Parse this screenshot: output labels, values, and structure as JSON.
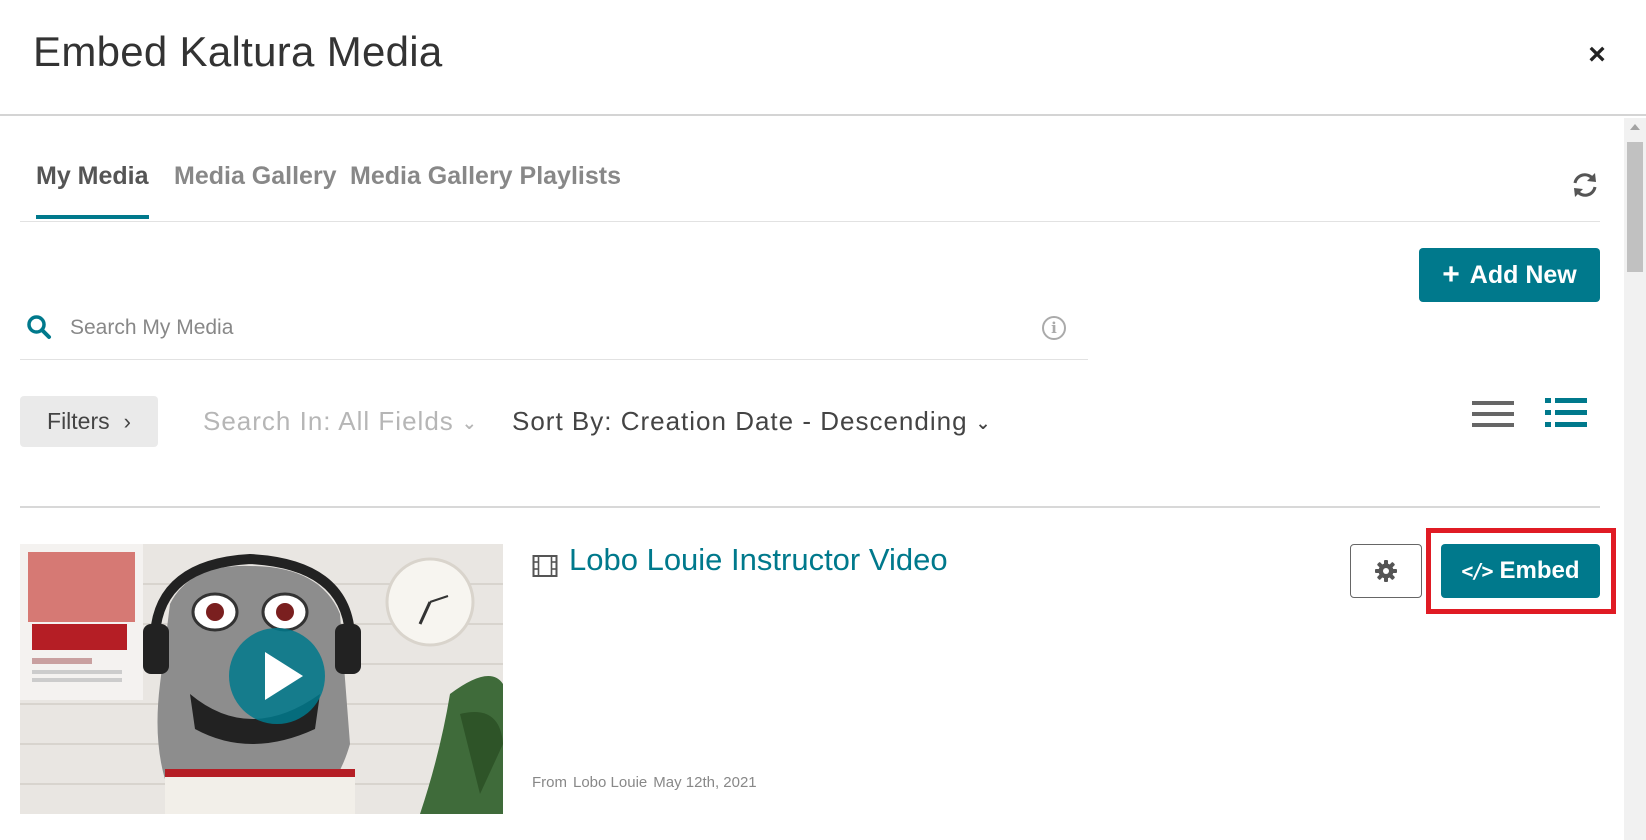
{
  "modal": {
    "title": "Embed Kaltura Media",
    "close_symbol": "×"
  },
  "tabs": [
    {
      "label": "My Media",
      "active": true
    },
    {
      "label": "Media Gallery",
      "active": false
    },
    {
      "label": "Media Gallery Playlists",
      "active": false
    }
  ],
  "toolbar": {
    "add_new_label": "Add New"
  },
  "search": {
    "placeholder": "Search My Media",
    "info_symbol": "i"
  },
  "filters": {
    "filters_label": "Filters",
    "search_in_label": "Search In: All Fields",
    "sort_by_label": "Sort By: Creation Date - Descending"
  },
  "media": {
    "title": "Lobo Louie Instructor Video",
    "from_label": "From",
    "author": "Lobo Louie",
    "date": "May 12th, 2021",
    "embed_label": "Embed"
  },
  "colors": {
    "accent": "#00798c",
    "highlight": "#e01b24"
  }
}
